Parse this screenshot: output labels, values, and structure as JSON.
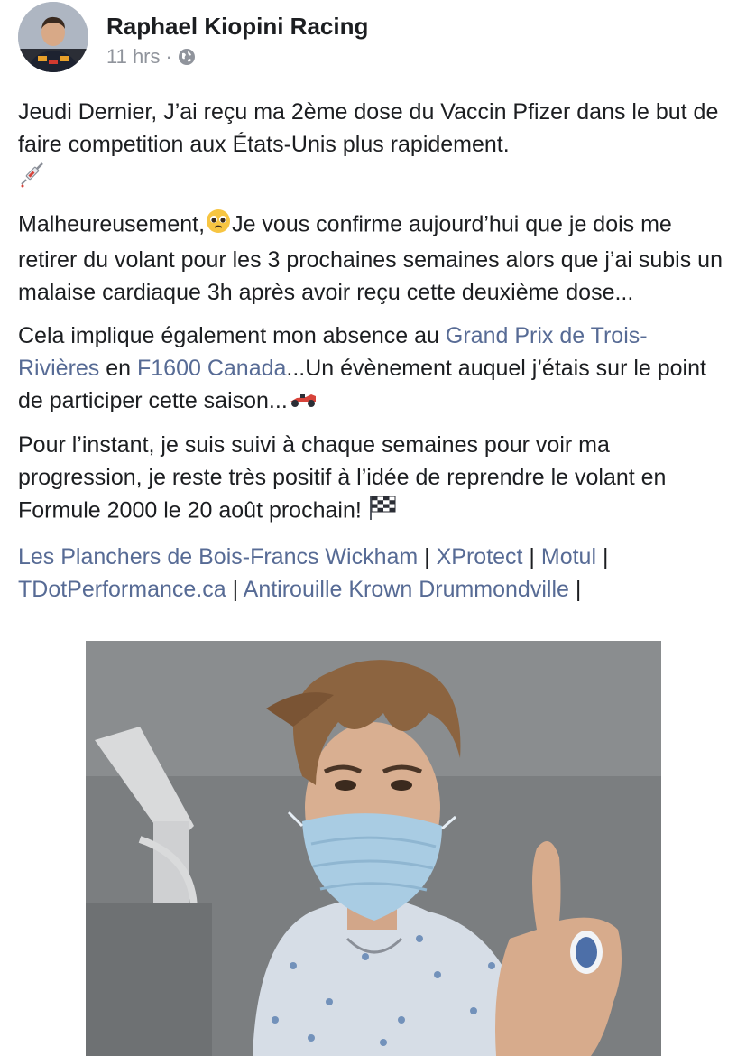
{
  "post": {
    "author": "Raphael Kiopini Racing",
    "time": "11 hrs",
    "separator": "·",
    "privacy_icon": "globe-icon"
  },
  "body": {
    "p1_text": "Jeudi Dernier, J’ai reçu ma 2ème dose du Vaccin Pfizer dans le but de faire competition aux États-Unis plus rapidement.",
    "p1_emoji": "syringe-icon",
    "p2_start": "Malheureusement,",
    "p2_emoji": "pleading-face-icon",
    "p2_rest": "Je vous confirme aujourd’hui que je dois me retirer du volant pour les 3 prochaines semaines alors que j’ai subis un malaise cardiaque 3h après avoir reçu cette deuxième dose...",
    "p3_start": "Cela implique également mon absence au ",
    "p3_link1": "Grand Prix de Trois-Rivières",
    "p3_mid": " en ",
    "p3_link2": "F1600 Canada",
    "p3_end": "...Un évènement auquel j’étais sur le point de participer cette saison...",
    "p3_emoji": "racing-car-icon",
    "p4_text": "Pour l’instant, je suis suivi à chaque semaines pour voir ma progression, je reste très positif à l’idée de reprendre le volant en Formule 2000 le 20 août prochain!",
    "p4_emoji": "checkered-flag-icon",
    "sponsors": [
      "Les Planchers de Bois-Francs Wickham",
      "XProtect",
      "Motul",
      "TDotPerformance.ca",
      "Antirouille Krown Drummondville"
    ],
    "sponsor_sep": " | ",
    "sponsor_trailing": " |"
  },
  "colors": {
    "link": "#576b95",
    "text": "#1c1e21",
    "meta": "#90949c"
  }
}
